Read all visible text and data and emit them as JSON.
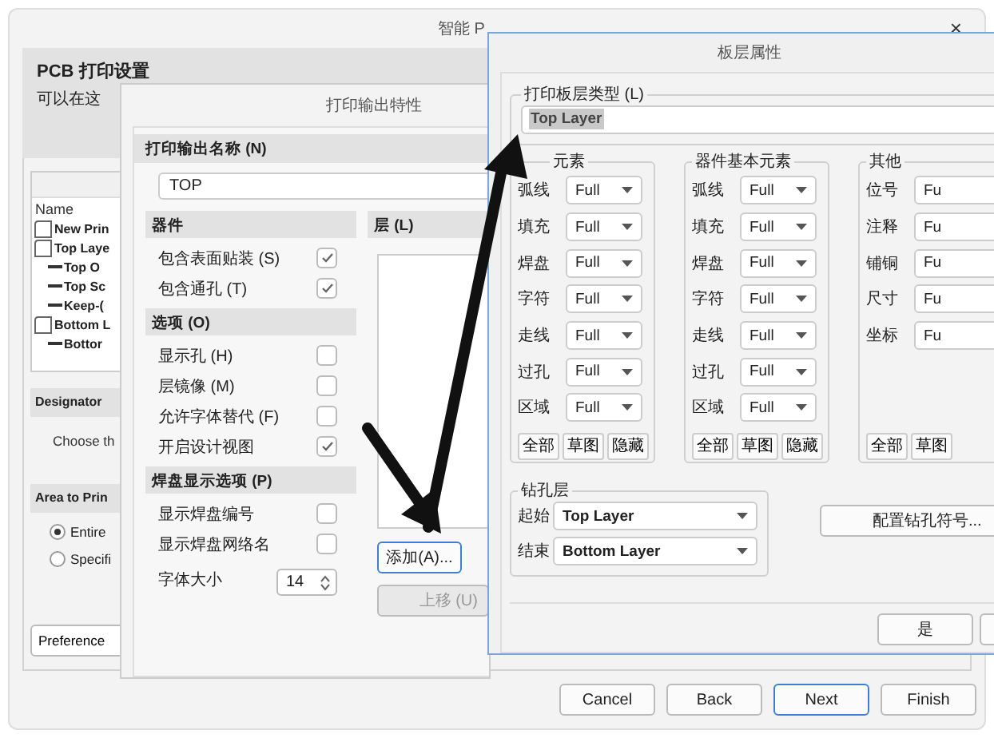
{
  "main_window": {
    "title": "智能 P",
    "close": "×",
    "header": {
      "title": "PCB 打印设置",
      "subtitle": "可以在这"
    },
    "tree": {
      "column_header": "Name",
      "items": [
        {
          "label": "New Prin"
        },
        {
          "label": "Top Laye",
          "children": [
            {
              "label": "Top O"
            },
            {
              "label": "Top Sc"
            },
            {
              "label": "Keep-("
            }
          ]
        },
        {
          "label": "Bottom L",
          "children": [
            {
              "label": "Bottor"
            }
          ]
        }
      ]
    },
    "designator": {
      "title": "Designator",
      "text": "Choose th"
    },
    "area": {
      "title": "Area to Prin",
      "options": [
        {
          "label": "Entire",
          "selected": true
        },
        {
          "label": "Specifi",
          "selected": false
        }
      ]
    },
    "preferences_button": "Preference",
    "buttons": [
      {
        "label": "Cancel",
        "focused": false
      },
      {
        "label": "Back",
        "focused": false
      },
      {
        "label": "Next",
        "focused": true
      },
      {
        "label": "Finish",
        "focused": false
      }
    ]
  },
  "output_dialog": {
    "title": "打印输出特性",
    "name_label": "打印输出名称 (N)",
    "name_value": "TOP",
    "sections": [
      {
        "title": "器件",
        "options": [
          {
            "kind": "checkbox",
            "label": "包含表面贴装 (S)",
            "checked": true
          },
          {
            "kind": "checkbox",
            "label": "包含通孔 (T)",
            "checked": true
          }
        ]
      },
      {
        "title": "选项 (O)",
        "options": [
          {
            "kind": "checkbox",
            "label": "显示孔 (H)",
            "checked": false
          },
          {
            "kind": "checkbox",
            "label": "层镜像 (M)",
            "checked": false
          },
          {
            "kind": "checkbox",
            "label": "允许字体替代 (F)",
            "checked": false
          },
          {
            "kind": "checkbox",
            "label": "开启设计视图",
            "checked": true
          }
        ]
      },
      {
        "title": "焊盘显示选项 (P)",
        "options": [
          {
            "kind": "checkbox",
            "label": "显示焊盘编号",
            "checked": false
          },
          {
            "kind": "checkbox",
            "label": "显示焊盘网络名",
            "checked": false
          },
          {
            "kind": "spinner",
            "label": "字体大小",
            "value": "14"
          }
        ]
      }
    ],
    "layers_title": "层 (L)",
    "add_button": {
      "label": "添加(A)...",
      "focused": true
    },
    "move_up_button": {
      "label": "上移 (U)",
      "disabled": true
    }
  },
  "layer_dialog": {
    "title": "板层属性",
    "layer_type": {
      "label": "打印板层类型 (L)",
      "value": "Top Layer",
      "selected": true
    },
    "groups": [
      {
        "title": "元素",
        "rows": [
          {
            "label": "弧线",
            "value": "Full"
          },
          {
            "label": "填充",
            "value": "Full"
          },
          {
            "label": "焊盘",
            "value": "Full"
          },
          {
            "label": "字符",
            "value": "Full"
          },
          {
            "label": "走线",
            "value": "Full"
          },
          {
            "label": "过孔",
            "value": "Full"
          },
          {
            "label": "区域",
            "value": "Full"
          }
        ],
        "buttons": [
          "全部",
          "草图",
          "隐藏"
        ]
      },
      {
        "title": "器件基本元素",
        "rows": [
          {
            "label": "弧线",
            "value": "Full"
          },
          {
            "label": "填充",
            "value": "Full"
          },
          {
            "label": "焊盘",
            "value": "Full"
          },
          {
            "label": "字符",
            "value": "Full"
          },
          {
            "label": "走线",
            "value": "Full"
          },
          {
            "label": "过孔",
            "value": "Full"
          },
          {
            "label": "区域",
            "value": "Full"
          }
        ],
        "buttons": [
          "全部",
          "草图",
          "隐藏"
        ]
      },
      {
        "title": "其他",
        "rows": [
          {
            "label": "位号",
            "value": "Fu"
          },
          {
            "label": "注释",
            "value": "Fu"
          },
          {
            "label": "铺铜",
            "value": "Fu"
          },
          {
            "label": "尺寸",
            "value": "Fu"
          },
          {
            "label": "坐标",
            "value": "Fu"
          }
        ],
        "buttons": [
          "全部",
          "草图"
        ]
      }
    ],
    "drill": {
      "title": "钻孔层",
      "rows": [
        {
          "label": "起始",
          "value": "Top Layer"
        },
        {
          "label": "结束",
          "value": "Bottom Layer"
        }
      ]
    },
    "config_button": "配置钻孔符号...",
    "ok_button": "是"
  }
}
